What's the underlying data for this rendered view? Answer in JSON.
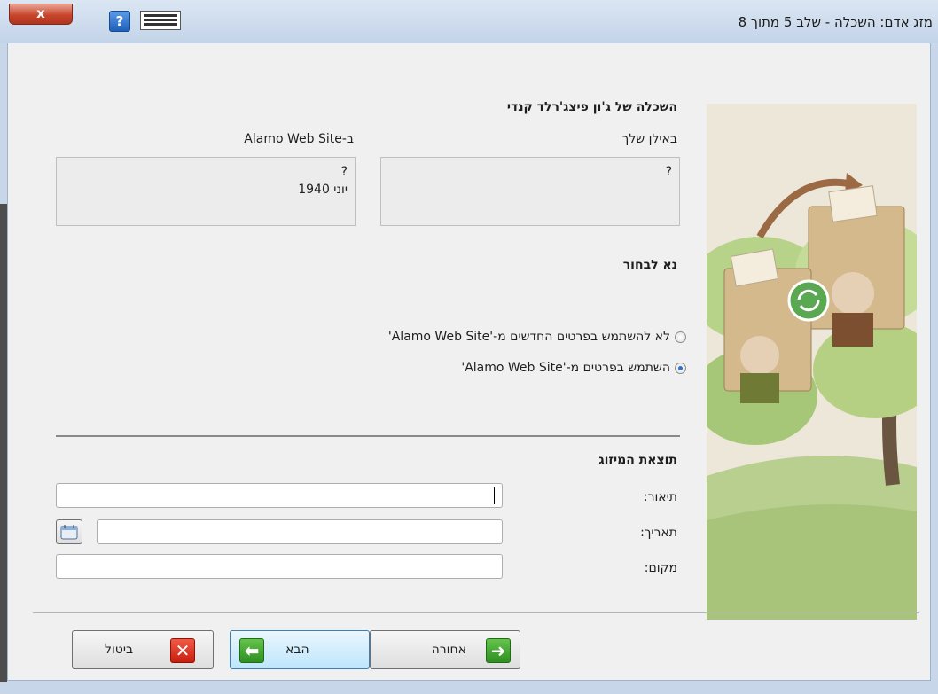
{
  "window": {
    "title": "מזג אדם: השכלה - שלב 5 מתוך 8",
    "close_glyph": "x",
    "help_glyph": "?"
  },
  "section_title": "השכלה של ג'ון פיצג'רלד קנדי",
  "compare": {
    "mine": {
      "heading": "באילן שלך",
      "line1": "?"
    },
    "site": {
      "heading": "ב-Alamo Web Site",
      "line1": "?",
      "line2": "יוני 1940"
    }
  },
  "choose": {
    "heading": "נא לבחור",
    "options": [
      {
        "label": "לא להשתמש בפרטים החדשים מ-'Alamo Web Site'",
        "selected": false
      },
      {
        "label": "השתמש בפרטים מ-'Alamo Web Site'",
        "selected": true
      }
    ]
  },
  "result": {
    "heading": "תוצאת המיזוג",
    "description_label": "תיאור:",
    "description_value": "",
    "date_label": "תאריך:",
    "date_value": "",
    "place_label": "מקום:",
    "place_value": ""
  },
  "buttons": {
    "back": "אחורה",
    "next": "הבא",
    "cancel": "ביטול"
  },
  "icons": {
    "close": "close-icon",
    "help": "help-icon",
    "keyboard": "keyboard-icon",
    "calendar": "calendar-icon",
    "back": "arrow-right-icon",
    "next": "arrow-left-icon",
    "cancel": "x-icon"
  },
  "colors": {
    "accent": "#3c7fb1",
    "green": "#2f8f21",
    "red": "#c91e0e"
  }
}
